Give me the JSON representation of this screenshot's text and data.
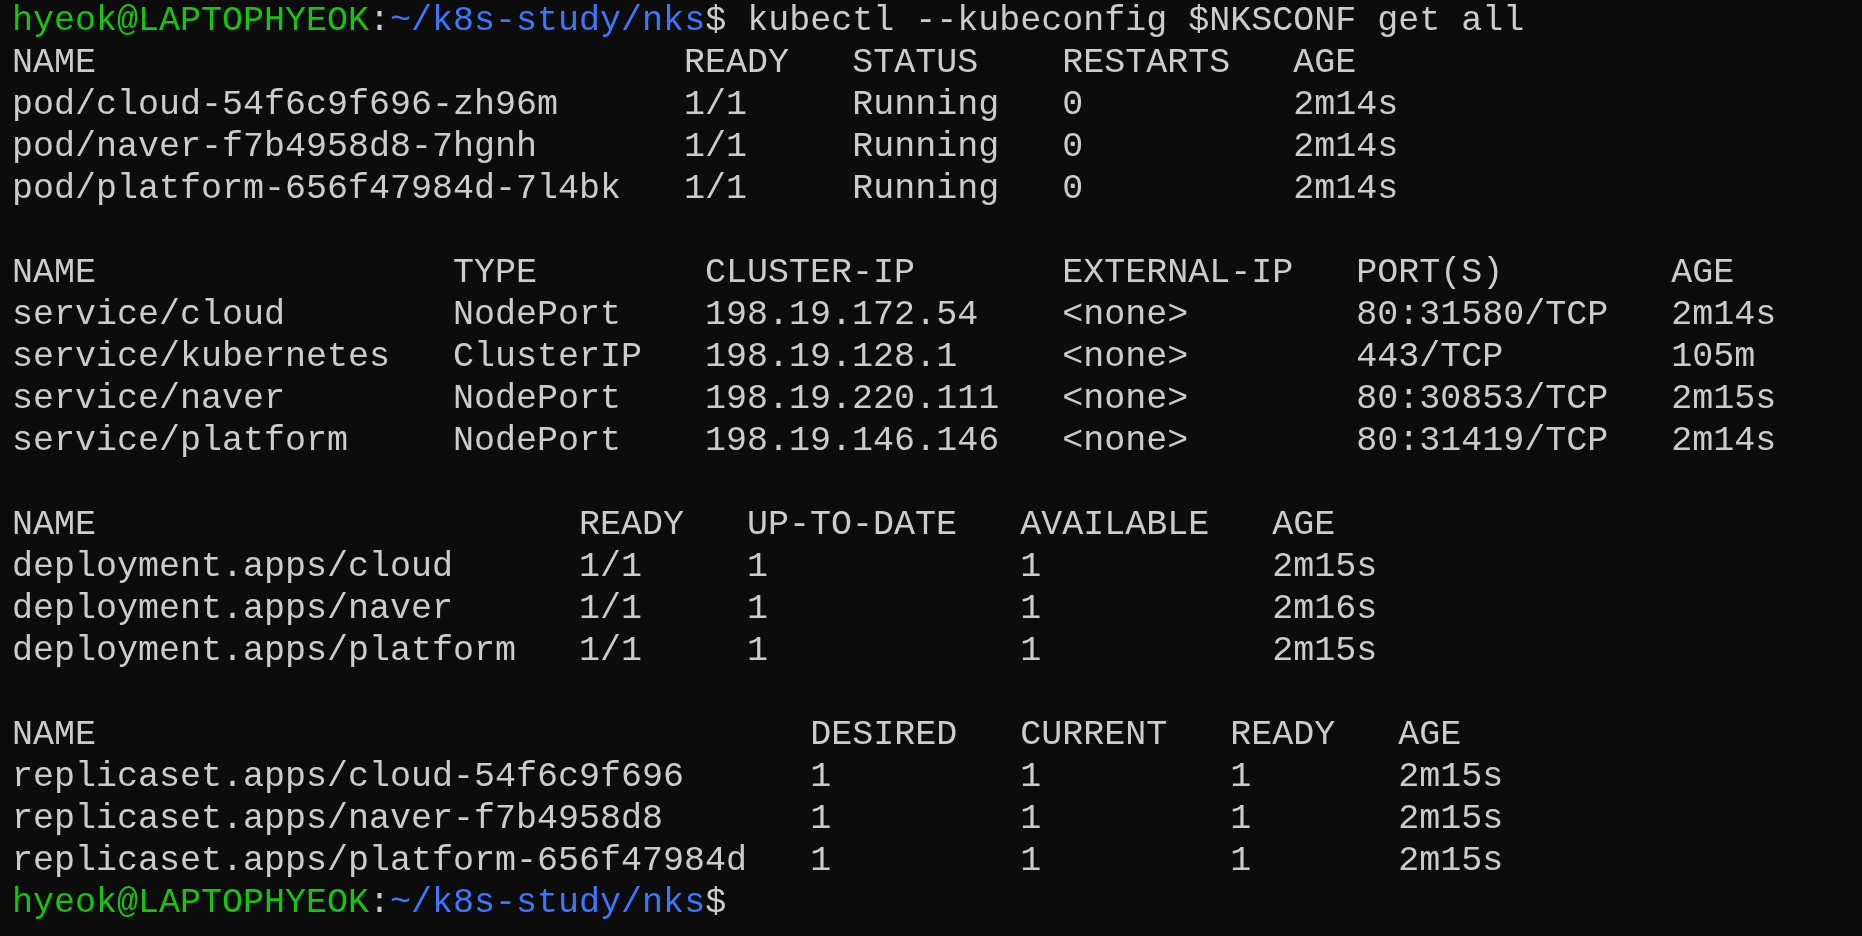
{
  "prompt": {
    "user_host": "hyeok@LAPTOPHYEOK",
    "separator": ":",
    "path": "~/k8s-study/nks",
    "symbol": "$",
    "command": "kubectl --kubeconfig $NKSCONF get all"
  },
  "tables": [
    {
      "columns": [
        "NAME",
        "READY",
        "STATUS",
        "RESTARTS",
        "AGE"
      ],
      "rows": [
        [
          "pod/cloud-54f6c9f696-zh96m",
          "1/1",
          "Running",
          "0",
          "2m14s"
        ],
        [
          "pod/naver-f7b4958d8-7hgnh",
          "1/1",
          "Running",
          "0",
          "2m14s"
        ],
        [
          "pod/platform-656f47984d-7l4bk",
          "1/1",
          "Running",
          "0",
          "2m14s"
        ]
      ]
    },
    {
      "columns": [
        "NAME",
        "TYPE",
        "CLUSTER-IP",
        "EXTERNAL-IP",
        "PORT(S)",
        "AGE"
      ],
      "rows": [
        [
          "service/cloud",
          "NodePort",
          "198.19.172.54",
          "<none>",
          "80:31580/TCP",
          "2m14s"
        ],
        [
          "service/kubernetes",
          "ClusterIP",
          "198.19.128.1",
          "<none>",
          "443/TCP",
          "105m"
        ],
        [
          "service/naver",
          "NodePort",
          "198.19.220.111",
          "<none>",
          "80:30853/TCP",
          "2m15s"
        ],
        [
          "service/platform",
          "NodePort",
          "198.19.146.146",
          "<none>",
          "80:31419/TCP",
          "2m14s"
        ]
      ]
    },
    {
      "columns": [
        "NAME",
        "READY",
        "UP-TO-DATE",
        "AVAILABLE",
        "AGE"
      ],
      "rows": [
        [
          "deployment.apps/cloud",
          "1/1",
          "1",
          "1",
          "2m15s"
        ],
        [
          "deployment.apps/naver",
          "1/1",
          "1",
          "1",
          "2m16s"
        ],
        [
          "deployment.apps/platform",
          "1/1",
          "1",
          "1",
          "2m15s"
        ]
      ]
    },
    {
      "columns": [
        "NAME",
        "DESIRED",
        "CURRENT",
        "READY",
        "AGE"
      ],
      "rows": [
        [
          "replicaset.apps/cloud-54f6c9f696",
          "1",
          "1",
          "1",
          "2m15s"
        ],
        [
          "replicaset.apps/naver-f7b4958d8",
          "1",
          "1",
          "1",
          "2m15s"
        ],
        [
          "replicaset.apps/platform-656f47984d",
          "1",
          "1",
          "1",
          "2m15s"
        ]
      ]
    }
  ],
  "final_prompt": {
    "user_host": "hyeok@LAPTOPHYEOK",
    "separator": ":",
    "path": "~/k8s-study/nks",
    "symbol": "$"
  }
}
